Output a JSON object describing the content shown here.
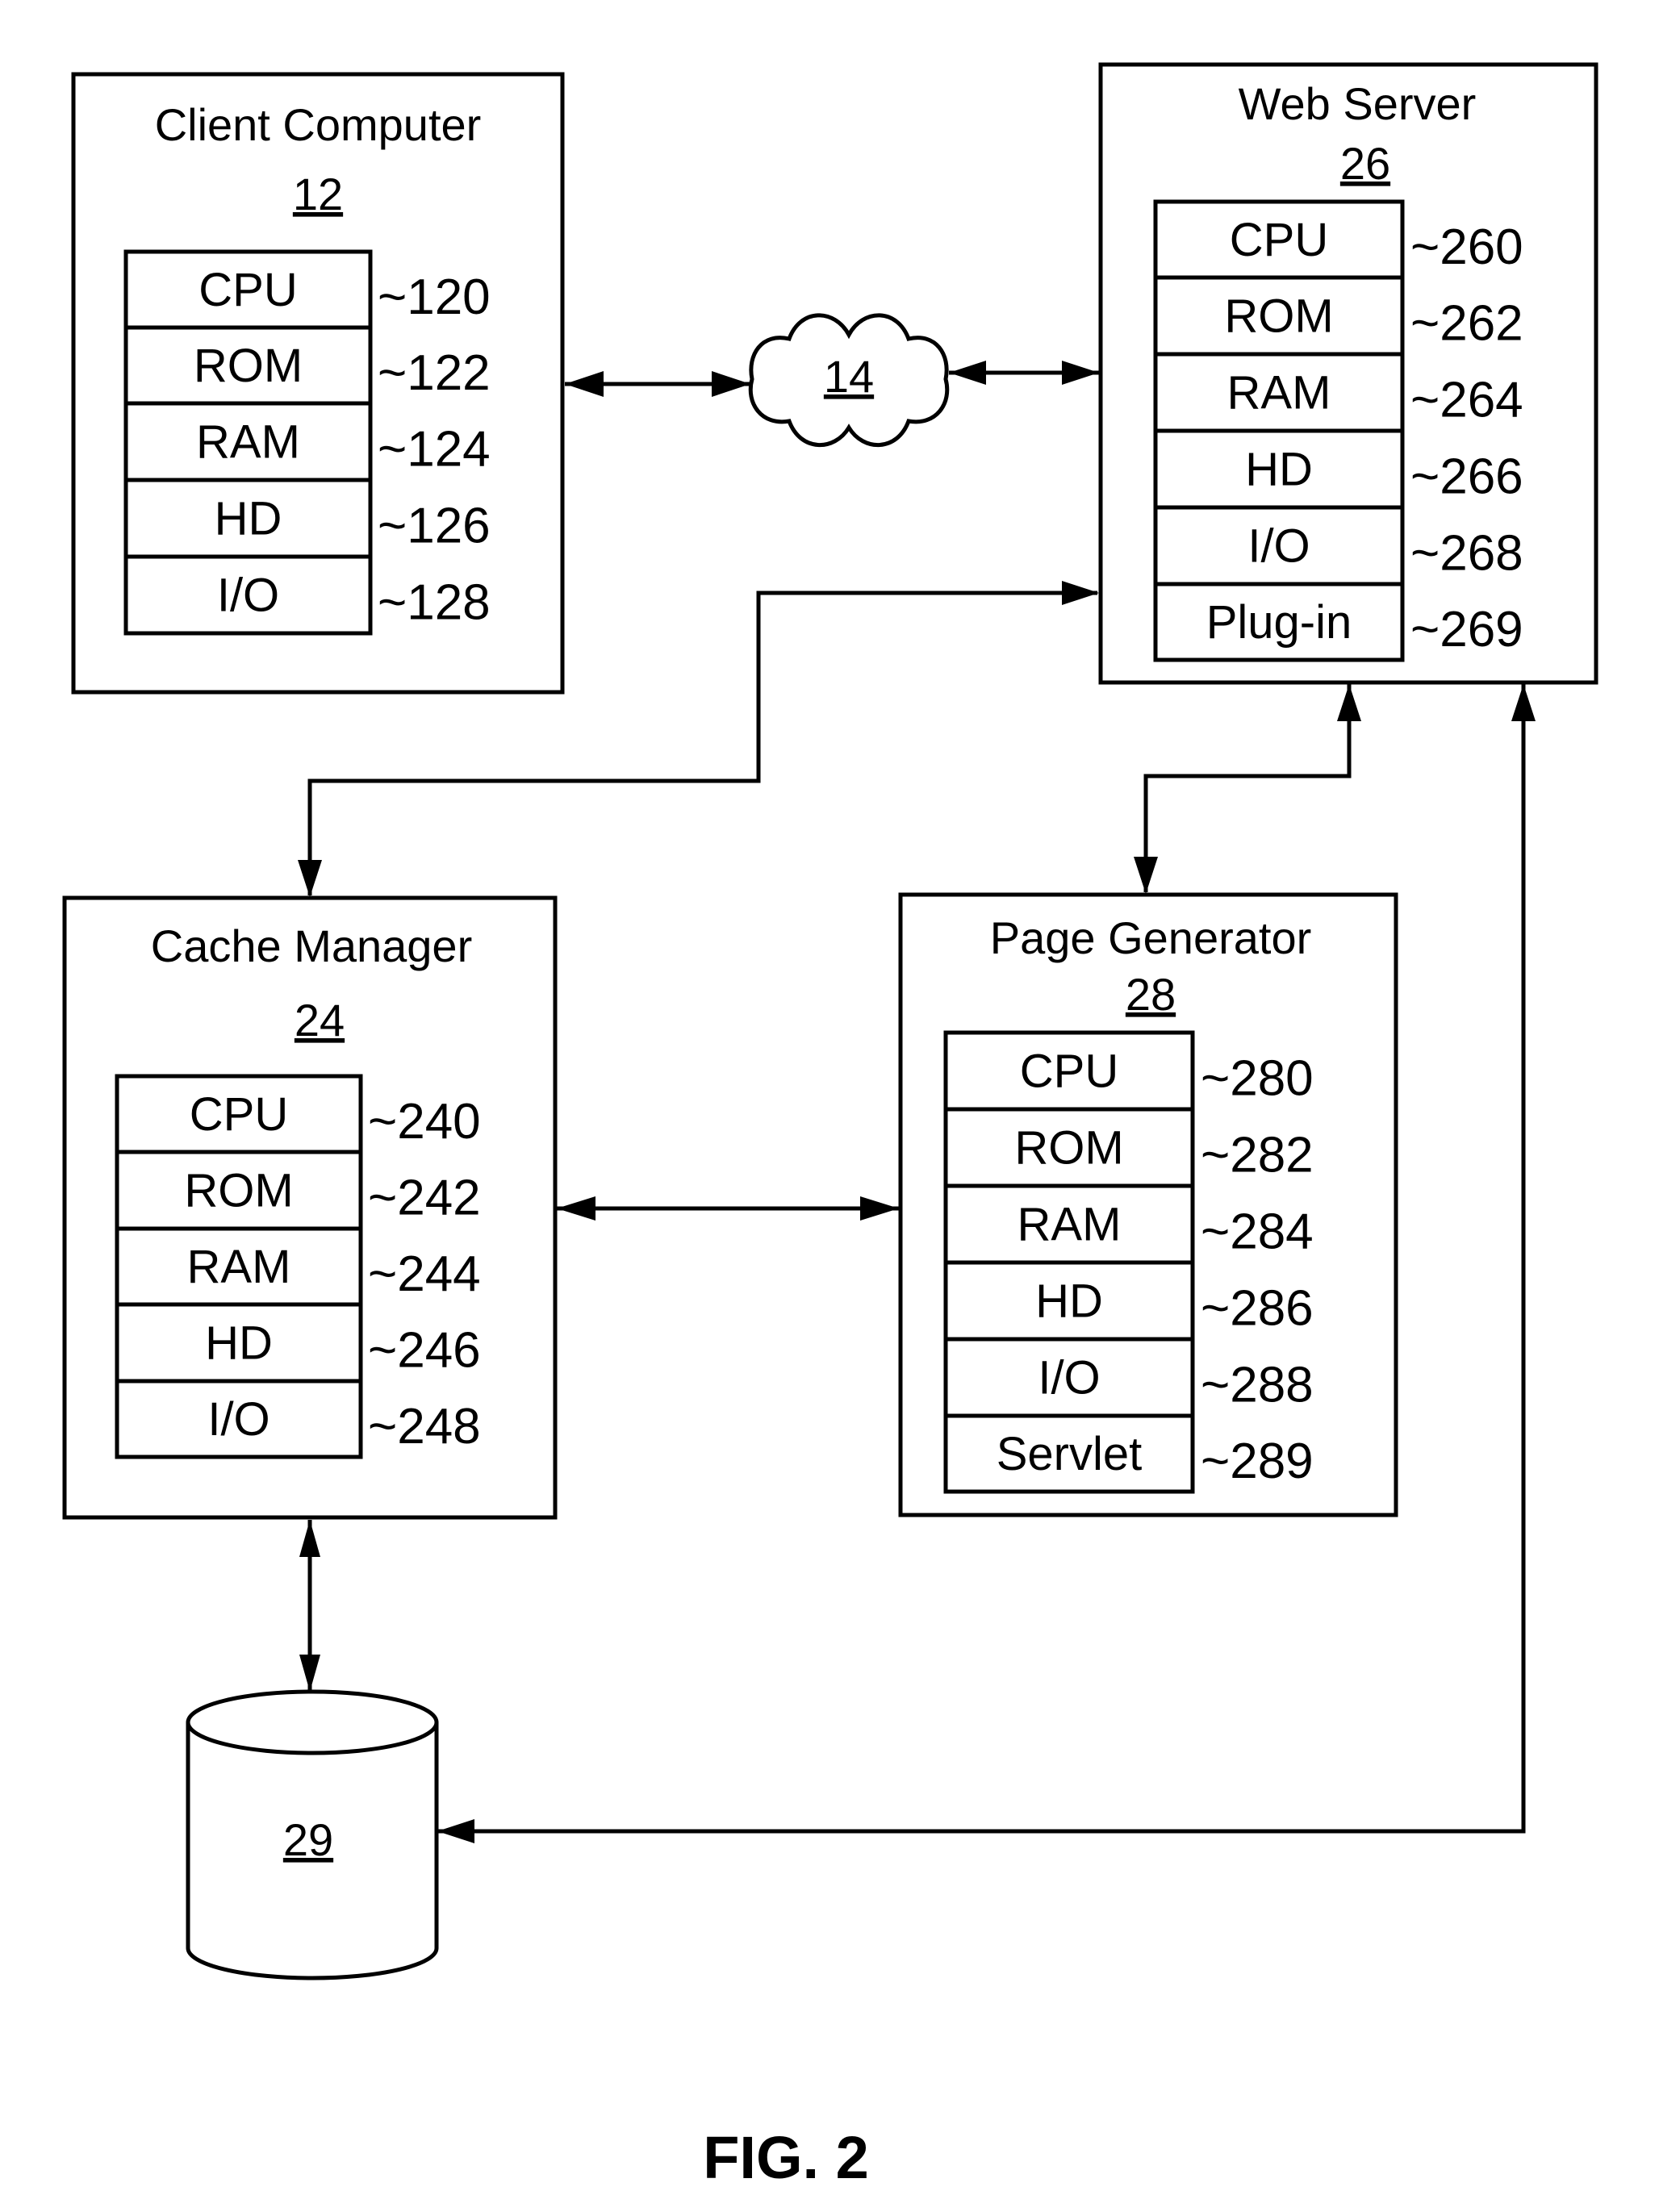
{
  "figure_label": "FIG. 2",
  "network": {
    "ref": "14"
  },
  "database": {
    "ref": "29"
  },
  "client_computer": {
    "title": "Client Computer",
    "ref": "12",
    "components": [
      {
        "label": "CPU",
        "ref": "~120"
      },
      {
        "label": "ROM",
        "ref": "~122"
      },
      {
        "label": "RAM",
        "ref": "~124"
      },
      {
        "label": "HD",
        "ref": "~126"
      },
      {
        "label": "I/O",
        "ref": "~128"
      }
    ]
  },
  "web_server": {
    "title": "Web Server",
    "ref": "26",
    "components": [
      {
        "label": "CPU",
        "ref": "~260"
      },
      {
        "label": "ROM",
        "ref": "~262"
      },
      {
        "label": "RAM",
        "ref": "~264"
      },
      {
        "label": "HD",
        "ref": "~266"
      },
      {
        "label": "I/O",
        "ref": "~268"
      },
      {
        "label": "Plug-in",
        "ref": "~269"
      }
    ]
  },
  "cache_manager": {
    "title": "Cache Manager",
    "ref": "24",
    "components": [
      {
        "label": "CPU",
        "ref": "~240"
      },
      {
        "label": "ROM",
        "ref": "~242"
      },
      {
        "label": "RAM",
        "ref": "~244"
      },
      {
        "label": "HD",
        "ref": "~246"
      },
      {
        "label": "I/O",
        "ref": "~248"
      }
    ]
  },
  "page_generator": {
    "title": "Page Generator",
    "ref": "28",
    "components": [
      {
        "label": "CPU",
        "ref": "~280"
      },
      {
        "label": "ROM",
        "ref": "~282"
      },
      {
        "label": "RAM",
        "ref": "~284"
      },
      {
        "label": "HD",
        "ref": "~286"
      },
      {
        "label": "I/O",
        "ref": "~288"
      },
      {
        "label": "Servlet",
        "ref": "~289"
      }
    ]
  },
  "connections": [
    {
      "from": "client_computer",
      "to": "network",
      "direction": "bidirectional"
    },
    {
      "from": "network",
      "to": "web_server",
      "direction": "bidirectional"
    },
    {
      "from": "web_server",
      "to": "cache_manager",
      "direction": "bidirectional"
    },
    {
      "from": "web_server",
      "to": "page_generator",
      "direction": "bidirectional"
    },
    {
      "from": "cache_manager",
      "to": "page_generator",
      "direction": "bidirectional"
    },
    {
      "from": "cache_manager",
      "to": "database",
      "direction": "bidirectional"
    },
    {
      "from": "web_server",
      "to": "database",
      "direction": "bidirectional"
    }
  ]
}
